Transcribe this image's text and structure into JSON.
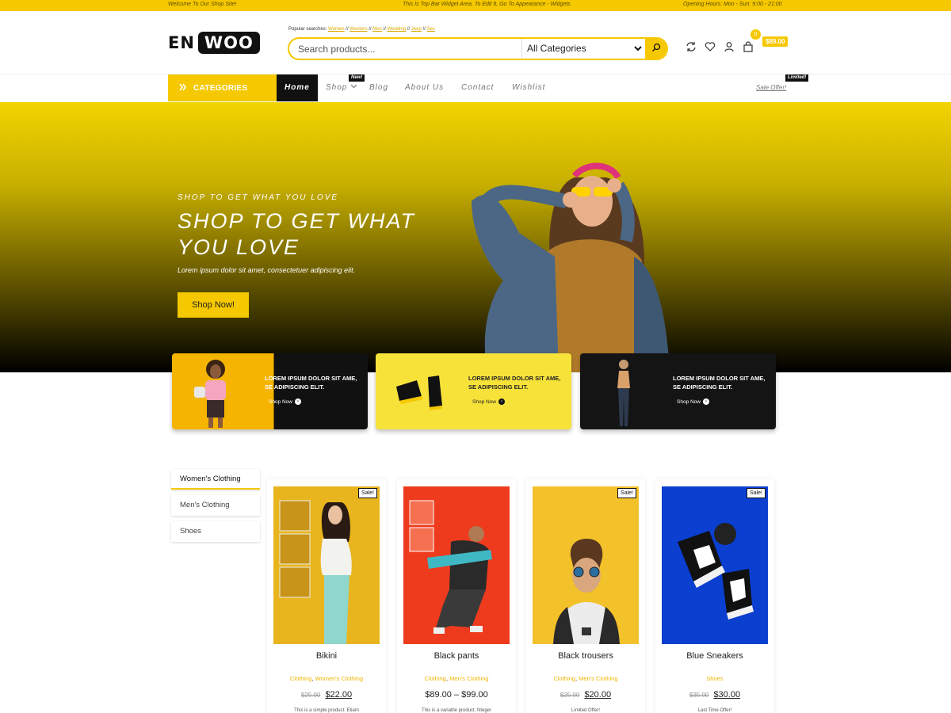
{
  "topbar": {
    "welcome": "Welcome To Our Shop Site!",
    "center": "This Is Top Bar Widget Area. To Edit It, Go To Appearance - Widgets",
    "hours": "Opening Hours: Mon - Sun: 9:00 - 21:00"
  },
  "header": {
    "logo_left": "EN",
    "logo_right": "WOO",
    "popular_label": "Popular searches:",
    "popular_terms": [
      "Women",
      "Western",
      "Men",
      "Wedding",
      "Jeep",
      "Sex"
    ],
    "search_placeholder": "Search products...",
    "category_select": "All Categories",
    "cart_count": "0",
    "cart_total": "$89.00"
  },
  "nav": {
    "categories_label": "CATEGORIES",
    "items": [
      {
        "label": "Home"
      },
      {
        "label": "Shop"
      },
      {
        "label": "Blog"
      },
      {
        "label": "About Us"
      },
      {
        "label": "Contact"
      },
      {
        "label": "Wishlist"
      }
    ],
    "shop_badge": "New!",
    "sale_offer": "Sale Offer!",
    "sale_badge": "Limited!"
  },
  "hero": {
    "kicker": "SHOP TO GET WHAT YOU LOVE",
    "title": "SHOP TO GET WHAT YOU LOVE",
    "description": "Lorem ipsum dolor sit amet, consectetuer adipiscing elit.",
    "button": "Shop Now!"
  },
  "promos": [
    {
      "line1": "LOREM IPSUM DOLOR SIT AME,",
      "line2": "SE ADIPISCING ELIT.",
      "link": "Shop Now"
    },
    {
      "line1": "LOREM IPSUM DOLOR SIT AME,",
      "line2": "SE ADIPISCING ELIT.",
      "link": "Shop Now"
    },
    {
      "line1": "LOREM IPSUM DOLOR SIT AME,",
      "line2": "SE ADIPISCING ELIT.",
      "link": "Shop Now"
    }
  ],
  "tabs": [
    "Women's Clothing",
    "Men's Clothing",
    "Shoes"
  ],
  "products": [
    {
      "name": "Bikini",
      "cat1": "Clothing",
      "cat2": "Women's Clothing",
      "old_price": "$25.00",
      "price": "$22.00",
      "note": "This is a simple product. Etiam",
      "sale": "Sale!"
    },
    {
      "name": "Black pants",
      "cat1": "Clothing",
      "cat2": "Men's Clothing",
      "old_price": "",
      "price": "$89.00 – $99.00",
      "note": "This is a variable product. Nteger",
      "sale": ""
    },
    {
      "name": "Black trousers",
      "cat1": "Clothing",
      "cat2": "Men's Clothing",
      "old_price": "$25.00",
      "price": "$20.00",
      "note": "Limited Offer!",
      "sale": "Sale!"
    },
    {
      "name": "Blue Sneakers",
      "cat1": "Shoes",
      "cat2": "",
      "old_price": "$35.00",
      "price": "$30.00",
      "note": "Last Time Offer!",
      "sale": "Sale!"
    }
  ],
  "colors": {
    "accent": "#f5c800",
    "dark": "#111111"
  }
}
